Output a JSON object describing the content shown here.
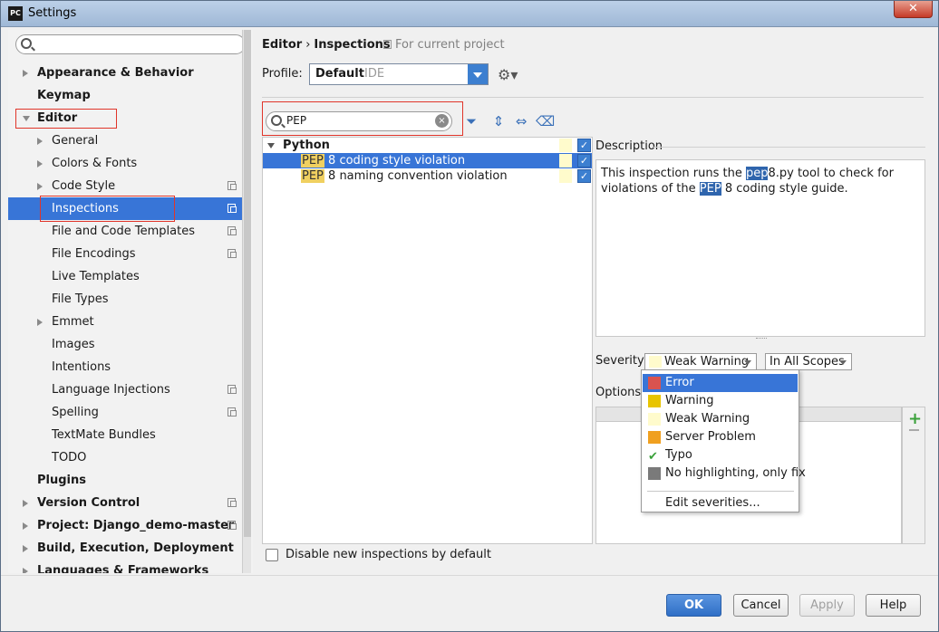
{
  "window": {
    "title": "Settings",
    "app_icon": "PC",
    "close": "✕"
  },
  "sidebar": {
    "search_placeholder": "",
    "items": [
      {
        "label": "Appearance & Behavior",
        "bold": true,
        "arrow": "right",
        "indent": 0,
        "copy": false
      },
      {
        "label": "Keymap",
        "bold": true,
        "arrow": "",
        "indent": 0,
        "copy": false
      },
      {
        "label": "Editor",
        "bold": true,
        "arrow": "down",
        "indent": 0,
        "copy": false
      },
      {
        "label": "General",
        "bold": false,
        "arrow": "right",
        "indent": 1,
        "copy": false
      },
      {
        "label": "Colors & Fonts",
        "bold": false,
        "arrow": "right",
        "indent": 1,
        "copy": false
      },
      {
        "label": "Code Style",
        "bold": false,
        "arrow": "right",
        "indent": 1,
        "copy": true
      },
      {
        "label": "Inspections",
        "bold": false,
        "arrow": "",
        "indent": 1,
        "copy": true,
        "selected": true
      },
      {
        "label": "File and Code Templates",
        "bold": false,
        "arrow": "",
        "indent": 1,
        "copy": true
      },
      {
        "label": "File Encodings",
        "bold": false,
        "arrow": "",
        "indent": 1,
        "copy": true
      },
      {
        "label": "Live Templates",
        "bold": false,
        "arrow": "",
        "indent": 1,
        "copy": false
      },
      {
        "label": "File Types",
        "bold": false,
        "arrow": "",
        "indent": 1,
        "copy": false
      },
      {
        "label": "Emmet",
        "bold": false,
        "arrow": "right",
        "indent": 1,
        "copy": false
      },
      {
        "label": "Images",
        "bold": false,
        "arrow": "",
        "indent": 1,
        "copy": false
      },
      {
        "label": "Intentions",
        "bold": false,
        "arrow": "",
        "indent": 1,
        "copy": false
      },
      {
        "label": "Language Injections",
        "bold": false,
        "arrow": "",
        "indent": 1,
        "copy": true
      },
      {
        "label": "Spelling",
        "bold": false,
        "arrow": "",
        "indent": 1,
        "copy": true
      },
      {
        "label": "TextMate Bundles",
        "bold": false,
        "arrow": "",
        "indent": 1,
        "copy": false
      },
      {
        "label": "TODO",
        "bold": false,
        "arrow": "",
        "indent": 1,
        "copy": false
      },
      {
        "label": "Plugins",
        "bold": true,
        "arrow": "",
        "indent": 0,
        "copy": false
      },
      {
        "label": "Version Control",
        "bold": true,
        "arrow": "right",
        "indent": 0,
        "copy": true
      },
      {
        "label": "Project: Django_demo-master",
        "bold": true,
        "arrow": "right",
        "indent": 0,
        "copy": true
      },
      {
        "label": "Build, Execution, Deployment",
        "bold": true,
        "arrow": "right",
        "indent": 0,
        "copy": false
      },
      {
        "label": "Languages & Frameworks",
        "bold": true,
        "arrow": "right",
        "indent": 0,
        "copy": false
      }
    ]
  },
  "header": {
    "crumb1": "Editor",
    "sep": "›",
    "crumb2": "Inspections",
    "for_project": "For current project"
  },
  "profile": {
    "label": "Profile:",
    "value": "Default",
    "scope": "IDE"
  },
  "inspection_search": {
    "value": "PEP",
    "clear": "×"
  },
  "tree": {
    "group": "Python",
    "rows": [
      {
        "hl": "PEP",
        "rest": " 8 coding style violation",
        "selected": true
      },
      {
        "hl": "PEP",
        "rest": " 8 naming convention violation",
        "selected": false
      }
    ],
    "check": "✓"
  },
  "description": {
    "title": "Description",
    "part1": "This inspection runs the ",
    "hl1": "pep",
    "part2": "8.py tool to check for violations of the ",
    "hl2": "PEP",
    "part3": " 8 coding style guide."
  },
  "severity": {
    "label": "Severity:",
    "value": "Weak Warning",
    "scope": "In All Scopes"
  },
  "options_label": "Options",
  "severity_menu": {
    "items": [
      {
        "label": "Error",
        "color": "#d9534f",
        "selected": true
      },
      {
        "label": "Warning",
        "color": "#e8c400",
        "selected": false
      },
      {
        "label": "Weak Warning",
        "color": "#fffbcc",
        "selected": false
      },
      {
        "label": "Server Problem",
        "color": "#f0a020",
        "selected": false
      },
      {
        "label": "Typo",
        "color": "",
        "selected": false
      },
      {
        "label": "No highlighting, only fix",
        "color": "#7a7a7a",
        "selected": false
      }
    ],
    "edit": "Edit severities..."
  },
  "disable_new": "Disable new inspections by default",
  "buttons": {
    "ok": "OK",
    "cancel": "Cancel",
    "apply": "Apply",
    "help": "Help"
  }
}
